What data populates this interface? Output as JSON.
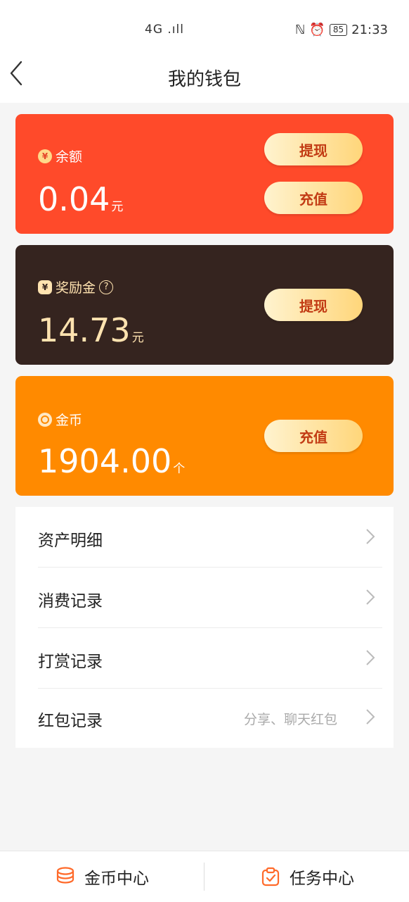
{
  "status_bar": {
    "network": "4G .ıll",
    "battery": "85",
    "time": "21:33"
  },
  "header": {
    "title": "我的钱包",
    "back_icon": "chevron-left-icon"
  },
  "cards": {
    "balance": {
      "label": "余额",
      "amount": "0.04",
      "unit": "元",
      "buttons": [
        "提现",
        "充值"
      ],
      "color": "#ff4a2a"
    },
    "reward": {
      "label": "奖励金",
      "amount": "14.73",
      "unit": "元",
      "button": "提现",
      "color": "#35241f"
    },
    "coins": {
      "label": "金币",
      "amount": "1904.00",
      "unit": "个",
      "button": "充值",
      "color": "#ff8a00"
    }
  },
  "menu": {
    "items": [
      {
        "label": "资产明细",
        "sub": ""
      },
      {
        "label": "消费记录",
        "sub": ""
      },
      {
        "label": "打赏记录",
        "sub": ""
      },
      {
        "label": "红包记录",
        "sub": "分享、聊天红包"
      }
    ]
  },
  "bottom_bar": {
    "left_label": "金币中心",
    "right_label": "任务中心",
    "accent": "#ff6a2a"
  }
}
